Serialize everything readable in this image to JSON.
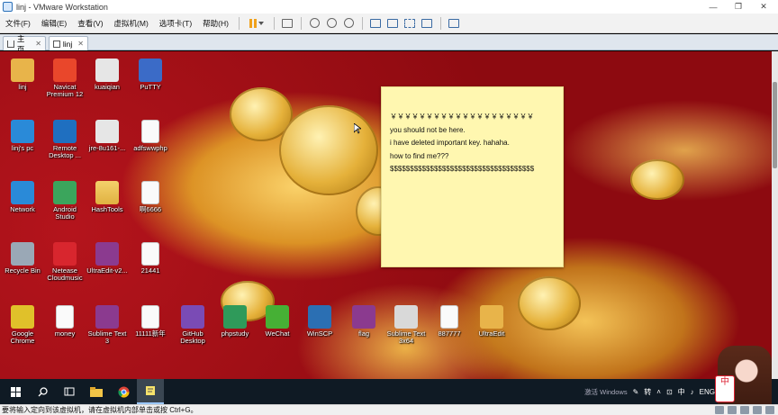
{
  "window": {
    "title": "linj - VMware Workstation",
    "controls": [
      "—",
      "❐",
      "✕"
    ]
  },
  "menu": {
    "items": [
      "文件(F)",
      "编辑(E)",
      "查看(V)",
      "虚拟机(M)",
      "选项卡(T)",
      "帮助(H)"
    ]
  },
  "tabs": [
    {
      "label": "主页",
      "close": "✕",
      "active": false
    },
    {
      "label": "linj",
      "close": "✕",
      "active": true
    }
  ],
  "desktop": {
    "icons": [
      {
        "label": "linj",
        "icon": "user-folder-icon",
        "color": "#e8b44a"
      },
      {
        "label": "Navicat Premium 12",
        "icon": "navicat-icon",
        "color": "#e9472b"
      },
      {
        "label": "kuaiqian",
        "icon": "image-file-icon",
        "color": "#e6e6e6"
      },
      {
        "label": "PuTTY",
        "icon": "putty-icon",
        "color": "#3b6bc7"
      },
      {
        "label": "linj's pc",
        "icon": "computer-icon",
        "color": "#2a8ad8"
      },
      {
        "label": "Remote Desktop ...",
        "icon": "remote-desktop-icon",
        "color": "#1f6fc0"
      },
      {
        "label": "jre-8u161-...",
        "icon": "java-installer-icon",
        "color": "#e6e6e6"
      },
      {
        "label": "adfswwphp",
        "icon": "document-icon",
        "color": "#fafafa"
      },
      {
        "label": "Network",
        "icon": "network-icon",
        "color": "#2a8ad8"
      },
      {
        "label": "Android Studio",
        "icon": "android-studio-icon",
        "color": "#3ba55c"
      },
      {
        "label": "HashTools",
        "icon": "folder-icon",
        "color": "#e8b44a"
      },
      {
        "label": "啊6666",
        "icon": "document-icon",
        "color": "#fafafa"
      },
      {
        "label": "Recycle Bin",
        "icon": "recycle-bin-icon",
        "color": "#9aa8b6"
      },
      {
        "label": "Netease Cloudmusic",
        "icon": "netease-music-icon",
        "color": "#d8262e"
      },
      {
        "label": "UltraEdit-v2...",
        "icon": "winrar-archive-icon",
        "color": "#8b3a8f"
      },
      {
        "label": "21441",
        "icon": "document-icon",
        "color": "#fafafa"
      },
      {
        "label": "Google Chrome",
        "icon": "chrome-icon",
        "color": "#e0c12a"
      },
      {
        "label": "money",
        "icon": "document-icon",
        "color": "#fafafa"
      },
      {
        "label": "Sublime Text 3",
        "icon": "winrar-archive-icon",
        "color": "#8b3a8f"
      },
      {
        "label": "11111新年",
        "icon": "document-icon",
        "color": "#fafafa"
      },
      {
        "label": "GitHub Desktop",
        "icon": "github-icon",
        "color": "#7a4bb5"
      },
      {
        "label": "phpstudy",
        "icon": "phpstudy-icon",
        "color": "#2f9a5a"
      },
      {
        "label": "WeChat",
        "icon": "wechat-icon",
        "color": "#46b035"
      },
      {
        "label": "WinSCP",
        "icon": "winscp-icon",
        "color": "#2b6fb3"
      },
      {
        "label": "flag",
        "icon": "winrar-archive-icon",
        "color": "#8b3a8f"
      },
      {
        "label": "Sublime Text 3x64",
        "icon": "archive-file-icon",
        "color": "#d9d9d9"
      },
      {
        "label": "887777",
        "icon": "document-icon",
        "color": "#fafafa"
      },
      {
        "label": "UltraEdit",
        "icon": "ultraedit-file-icon",
        "color": "#e8b44a"
      }
    ]
  },
  "sticky_note": {
    "lines": [
      "￥￥￥￥￥￥￥￥￥￥￥￥￥￥￥￥￥￥￥￥",
      "you should not be here.",
      "i have deleted important key. hahaha.",
      "how  to find me???",
      "$$$$$$$$$$$$$$$$$$$$$$$$$$$$$$$$$$$$"
    ]
  },
  "taskbar": {
    "tray_text": "转",
    "tray_ime": "中",
    "tray_lang": "ENG",
    "watermark": "激活 Windows"
  },
  "statusbar": {
    "message": "要将输入定向到该虚拟机，请在虚拟机内部单击或按 Ctrl+G。"
  },
  "mascot_badge": "中"
}
